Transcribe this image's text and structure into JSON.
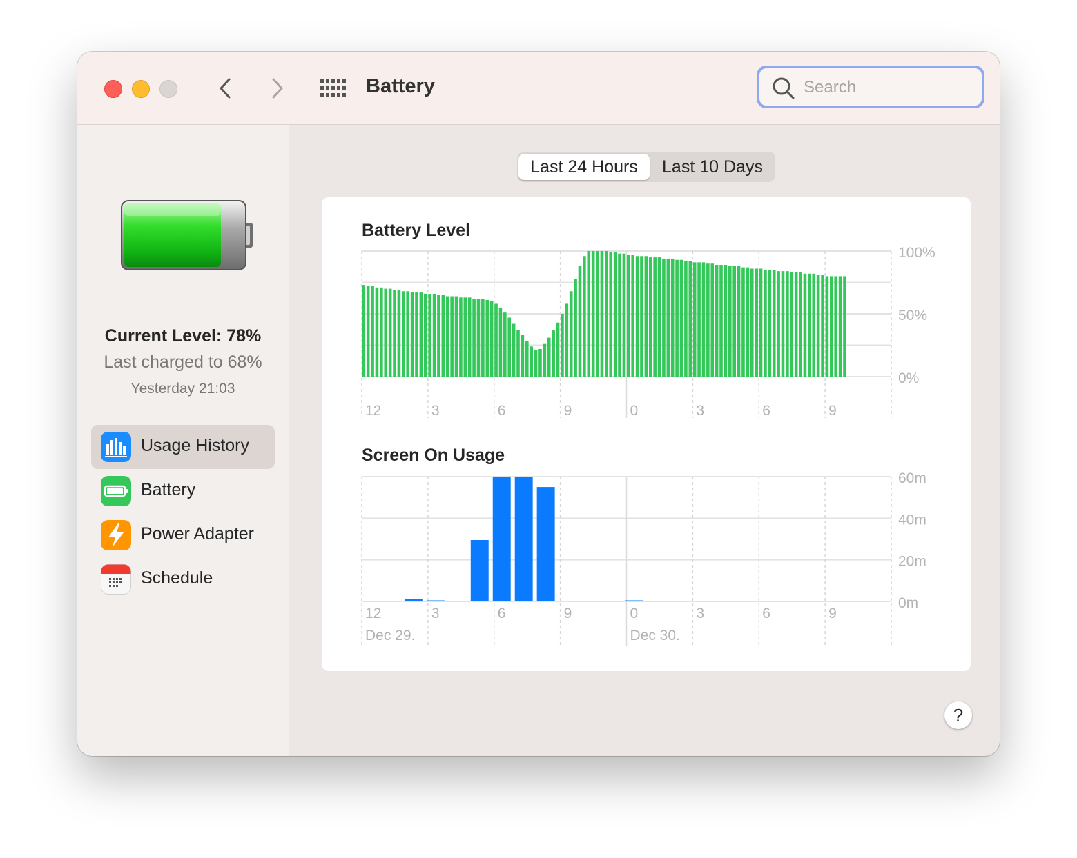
{
  "window": {
    "title": "Battery",
    "search": {
      "placeholder": "Search",
      "value": ""
    },
    "icons": {
      "back": "chevron-left-icon",
      "forward": "chevron-right-icon",
      "all_prefs": "grid-icon",
      "search": "magnifier-icon"
    }
  },
  "sidebar": {
    "current_level": "Current Level: 78%",
    "last_charged": "Last charged to 68%",
    "last_charged_time": "Yesterday 21:03",
    "items": [
      {
        "label": "Usage History",
        "icon": "bar-chart-icon",
        "selected": true
      },
      {
        "label": "Battery",
        "icon": "battery-icon",
        "selected": false
      },
      {
        "label": "Power Adapter",
        "icon": "lightning-icon",
        "selected": false
      },
      {
        "label": "Schedule",
        "icon": "calendar-icon",
        "selected": false
      }
    ]
  },
  "segmented": {
    "options": [
      "Last 24 Hours",
      "Last 10 Days"
    ],
    "selected": 0
  },
  "help_label": "?",
  "chart_data": [
    {
      "type": "bar",
      "title": "Battery Level",
      "x_ticks": [
        "12",
        "3",
        "6",
        "9",
        "0",
        "3",
        "6",
        "9"
      ],
      "y_ticks": [
        "100%",
        "50%",
        "0%"
      ],
      "ylim": [
        0,
        100
      ],
      "color": "#34c759",
      "charging_color": "#b8ecbf",
      "charging_interval": [
        7.4,
        9.0
      ],
      "x_range": [
        12,
        36
      ],
      "series": [
        {
          "x": [
            12.0,
            12.2,
            12.4,
            12.6,
            12.8,
            13.0,
            13.2,
            13.4,
            13.6,
            13.8,
            14.0,
            14.2,
            14.4,
            14.6,
            14.8,
            15.0,
            15.2,
            15.4,
            15.6,
            15.8,
            16.0,
            16.2,
            16.4,
            16.6,
            16.8,
            17.0,
            17.2,
            17.4,
            17.6,
            17.8,
            18.0,
            18.2,
            18.4,
            18.6,
            18.8,
            19.0,
            19.2,
            19.4,
            19.6,
            19.8,
            20.0,
            20.2,
            20.4,
            20.6,
            20.8,
            21.0,
            21.2,
            21.4,
            21.6,
            21.8,
            22.0,
            22.2,
            22.4,
            22.6,
            22.8,
            23.0,
            23.2,
            23.4,
            23.6,
            23.8,
            24.0,
            24.2,
            24.4,
            24.6,
            24.8,
            25.0,
            25.2,
            25.4,
            25.6,
            25.8,
            26.0,
            26.2,
            26.4,
            26.6,
            26.8,
            27.0,
            27.2,
            27.4,
            27.6,
            27.8,
            28.0,
            28.2,
            28.4,
            28.6,
            28.8,
            29.0,
            29.2,
            29.4,
            29.6,
            29.8,
            30.0,
            30.2,
            30.4,
            30.6,
            30.8,
            31.0,
            31.2,
            31.4,
            31.6,
            31.8,
            32.0,
            32.2,
            32.4,
            32.6,
            32.8,
            33.0,
            33.2,
            33.4,
            33.6,
            33.8
          ],
          "values": [
            73,
            72,
            72,
            71,
            71,
            70,
            70,
            69,
            69,
            68,
            68,
            67,
            67,
            67,
            66,
            66,
            66,
            65,
            65,
            64,
            64,
            64,
            63,
            63,
            63,
            62,
            62,
            62,
            61,
            60,
            58,
            55,
            51,
            47,
            42,
            37,
            33,
            28,
            24,
            21,
            22,
            26,
            31,
            37,
            43,
            50,
            58,
            68,
            78,
            88,
            96,
            100,
            100,
            100,
            100,
            100,
            99,
            99,
            98,
            98,
            97,
            97,
            96,
            96,
            96,
            95,
            95,
            95,
            94,
            94,
            94,
            93,
            93,
            92,
            92,
            91,
            91,
            91,
            90,
            90,
            89,
            89,
            89,
            88,
            88,
            88,
            87,
            87,
            86,
            86,
            86,
            85,
            85,
            85,
            84,
            84,
            84,
            83,
            83,
            83,
            82,
            82,
            82,
            81,
            81,
            80,
            80,
            80,
            80,
            80
          ]
        }
      ]
    },
    {
      "type": "bar",
      "title": "Screen On Usage",
      "x_ticks": [
        "12",
        "3",
        "6",
        "9",
        "0",
        "3",
        "6",
        "9"
      ],
      "date_labels": [
        "Dec 29.",
        "Dec 30."
      ],
      "y_ticks": [
        "60m",
        "40m",
        "20m",
        "0m"
      ],
      "ylim": [
        0,
        60
      ],
      "color": "#0a7bff",
      "series": [
        {
          "x": [
            14,
            15,
            17,
            18,
            19,
            20,
            24
          ],
          "values": [
            1,
            0.3,
            29.5,
            60,
            60,
            55,
            0.3
          ]
        }
      ]
    }
  ]
}
